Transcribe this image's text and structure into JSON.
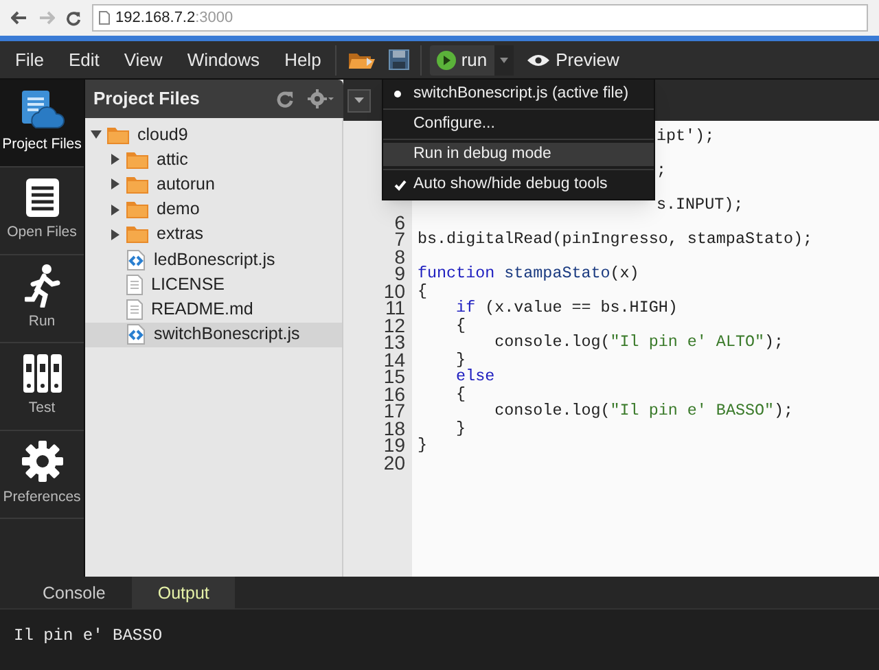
{
  "browser": {
    "url_host": "192.168.7.2",
    "url_port": ":3000"
  },
  "menu_bar": {
    "items": [
      "File",
      "Edit",
      "View",
      "Windows",
      "Help"
    ],
    "run_button": "run",
    "preview_button": "Preview"
  },
  "sidebar": {
    "items": [
      {
        "label": "Project Files",
        "kind": "project",
        "selected": true
      },
      {
        "label": "Open Files",
        "kind": "open",
        "selected": false
      },
      {
        "label": "Run",
        "kind": "run",
        "selected": false
      },
      {
        "label": "Test",
        "kind": "test",
        "selected": false
      },
      {
        "label": "Preferences",
        "kind": "prefs",
        "selected": false
      }
    ]
  },
  "project_panel": {
    "title": "Project Files",
    "tree": [
      {
        "name": "cloud9",
        "kind": "folder",
        "expanded": true,
        "selected": false,
        "children": [
          {
            "name": "attic",
            "kind": "folder",
            "expanded": false,
            "selected": false
          },
          {
            "name": "autorun",
            "kind": "folder",
            "expanded": false,
            "selected": false
          },
          {
            "name": "demo",
            "kind": "folder",
            "expanded": false,
            "selected": false
          },
          {
            "name": "extras",
            "kind": "folder",
            "expanded": false,
            "selected": false
          },
          {
            "name": "ledBonescript.js",
            "kind": "js",
            "selected": false
          },
          {
            "name": "LICENSE",
            "kind": "file",
            "selected": false
          },
          {
            "name": "README.md",
            "kind": "file",
            "selected": false
          },
          {
            "name": "switchBonescript.js",
            "kind": "js",
            "selected": true
          }
        ]
      }
    ]
  },
  "run_menu": {
    "items": [
      {
        "label": "switchBonescript.js (active file)",
        "kind": "radio",
        "checked": true,
        "highlighted": false
      },
      {
        "label": "Configure...",
        "kind": "action",
        "highlighted": false
      },
      {
        "label": "Run in debug mode",
        "kind": "action",
        "highlighted": true
      },
      {
        "label": "Auto show/hide debug tools",
        "kind": "check",
        "checked": true,
        "highlighted": false
      }
    ]
  },
  "editor": {
    "lines": [
      {
        "tokens": [
          {
            "text": "ipt');",
            "kind": "plain"
          }
        ]
      },
      {
        "tokens": [
          {
            "text": ";",
            "kind": "plain"
          }
        ]
      },
      {
        "tokens": [
          {
            "text": "s.INPUT);",
            "kind": "plain"
          }
        ]
      },
      {
        "number": "6"
      },
      {
        "number": "7",
        "tokens": [
          {
            "text": "bs.digitalRead(pinIngresso, stampaStato);",
            "kind": "plain"
          }
        ]
      },
      {
        "number": "8"
      },
      {
        "number": "9",
        "tokens": [
          {
            "text": "function",
            "kind": "keyword"
          },
          {
            "text": " stampaStato",
            "kind": "name"
          },
          {
            "text": "(x)",
            "kind": "plain"
          }
        ]
      },
      {
        "number": "10",
        "tokens": [
          {
            "text": "{",
            "kind": "plain"
          }
        ]
      },
      {
        "number": "11",
        "tokens": [
          {
            "text": "    if",
            "kind": "keyword"
          },
          {
            "text": " (x.value == bs.HIGH)",
            "kind": "plain"
          }
        ]
      },
      {
        "number": "12",
        "tokens": [
          {
            "text": "    {",
            "kind": "plain"
          }
        ]
      },
      {
        "number": "13",
        "tokens": [
          {
            "text": "        console.log(",
            "kind": "plain"
          },
          {
            "text": "\"Il pin e' ALTO\"",
            "kind": "string"
          },
          {
            "text": ");",
            "kind": "plain"
          }
        ]
      },
      {
        "number": "14",
        "tokens": [
          {
            "text": "    }",
            "kind": "plain"
          }
        ]
      },
      {
        "number": "15",
        "tokens": [
          {
            "text": "    else",
            "kind": "keyword"
          }
        ]
      },
      {
        "number": "16",
        "tokens": [
          {
            "text": "    {",
            "kind": "plain"
          }
        ]
      },
      {
        "number": "17",
        "tokens": [
          {
            "text": "        console.log(",
            "kind": "plain"
          },
          {
            "text": "\"Il pin e' BASSO\"",
            "kind": "string"
          },
          {
            "text": ");",
            "kind": "plain"
          }
        ]
      },
      {
        "number": "18",
        "tokens": [
          {
            "text": "    }",
            "kind": "plain"
          }
        ]
      },
      {
        "number": "19",
        "tokens": [
          {
            "text": "}",
            "kind": "plain"
          }
        ]
      },
      {
        "number": "20"
      }
    ]
  },
  "bottom_panel": {
    "tabs": [
      {
        "label": "Console",
        "selected": false
      },
      {
        "label": "Output",
        "selected": true
      }
    ],
    "output": "Il pin e' BASSO"
  }
}
